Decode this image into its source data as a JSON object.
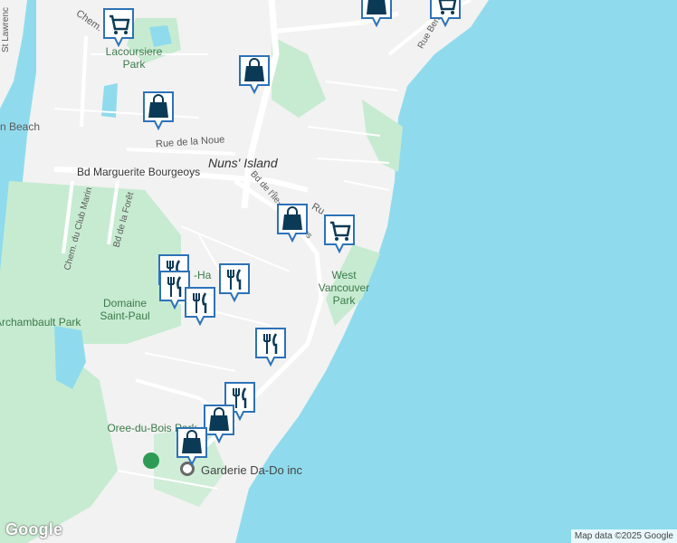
{
  "map": {
    "water_color": "#8fdbed",
    "land_color": "#f2f2f2",
    "park_color": "#c7ebd1",
    "pin_fill": "#ffffff",
    "pin_icon_color": "#0b3a57",
    "pin_border": "#2d72b8"
  },
  "labels": {
    "nuns_island": "Nuns' Island",
    "bd_marguerite": "Bd Marguerite Bourgeoys",
    "rue_noue": "Rue de la Noue",
    "chem": "Chem.",
    "lacoursiere": "Lacoursiere Park",
    "beach": "n Beach",
    "chem_club_marin": "Chem. du Club Marin",
    "bd_foret": "Bd de la Forêt",
    "domaine": "Domaine Saint-Paul",
    "archambault": "Archambault Park",
    "west_vancouver": "West Vancouver Park",
    "oree": "Oree-du-Bois Park",
    "garderie": "Garderie Da-Do inc",
    "bd_ile_des_soeurs": "Bd de l'Île-des-Sœurs",
    "ru": "Ru",
    "rue_berlioz": "Rue Berlioz",
    "st_lawrence": "St Lawrenc",
    "cha_ha": "-Ha",
    "bd_small": "Bd",
    "googl": "Google",
    "credit": "Map data ©2025 Google"
  },
  "pins": [
    {
      "type": "cart-icon"
    },
    {
      "type": "bag-icon"
    },
    {
      "type": "bag-icon"
    },
    {
      "type": "bag-icon"
    },
    {
      "type": "cart-icon"
    },
    {
      "type": "bag-icon"
    },
    {
      "type": "cart-icon"
    },
    {
      "type": "restaurant-icon"
    },
    {
      "type": "restaurant-icon"
    },
    {
      "type": "restaurant-icon"
    },
    {
      "type": "restaurant-icon"
    },
    {
      "type": "restaurant-icon"
    },
    {
      "type": "restaurant-icon"
    },
    {
      "type": "bag-icon"
    },
    {
      "type": "bag-icon"
    }
  ]
}
